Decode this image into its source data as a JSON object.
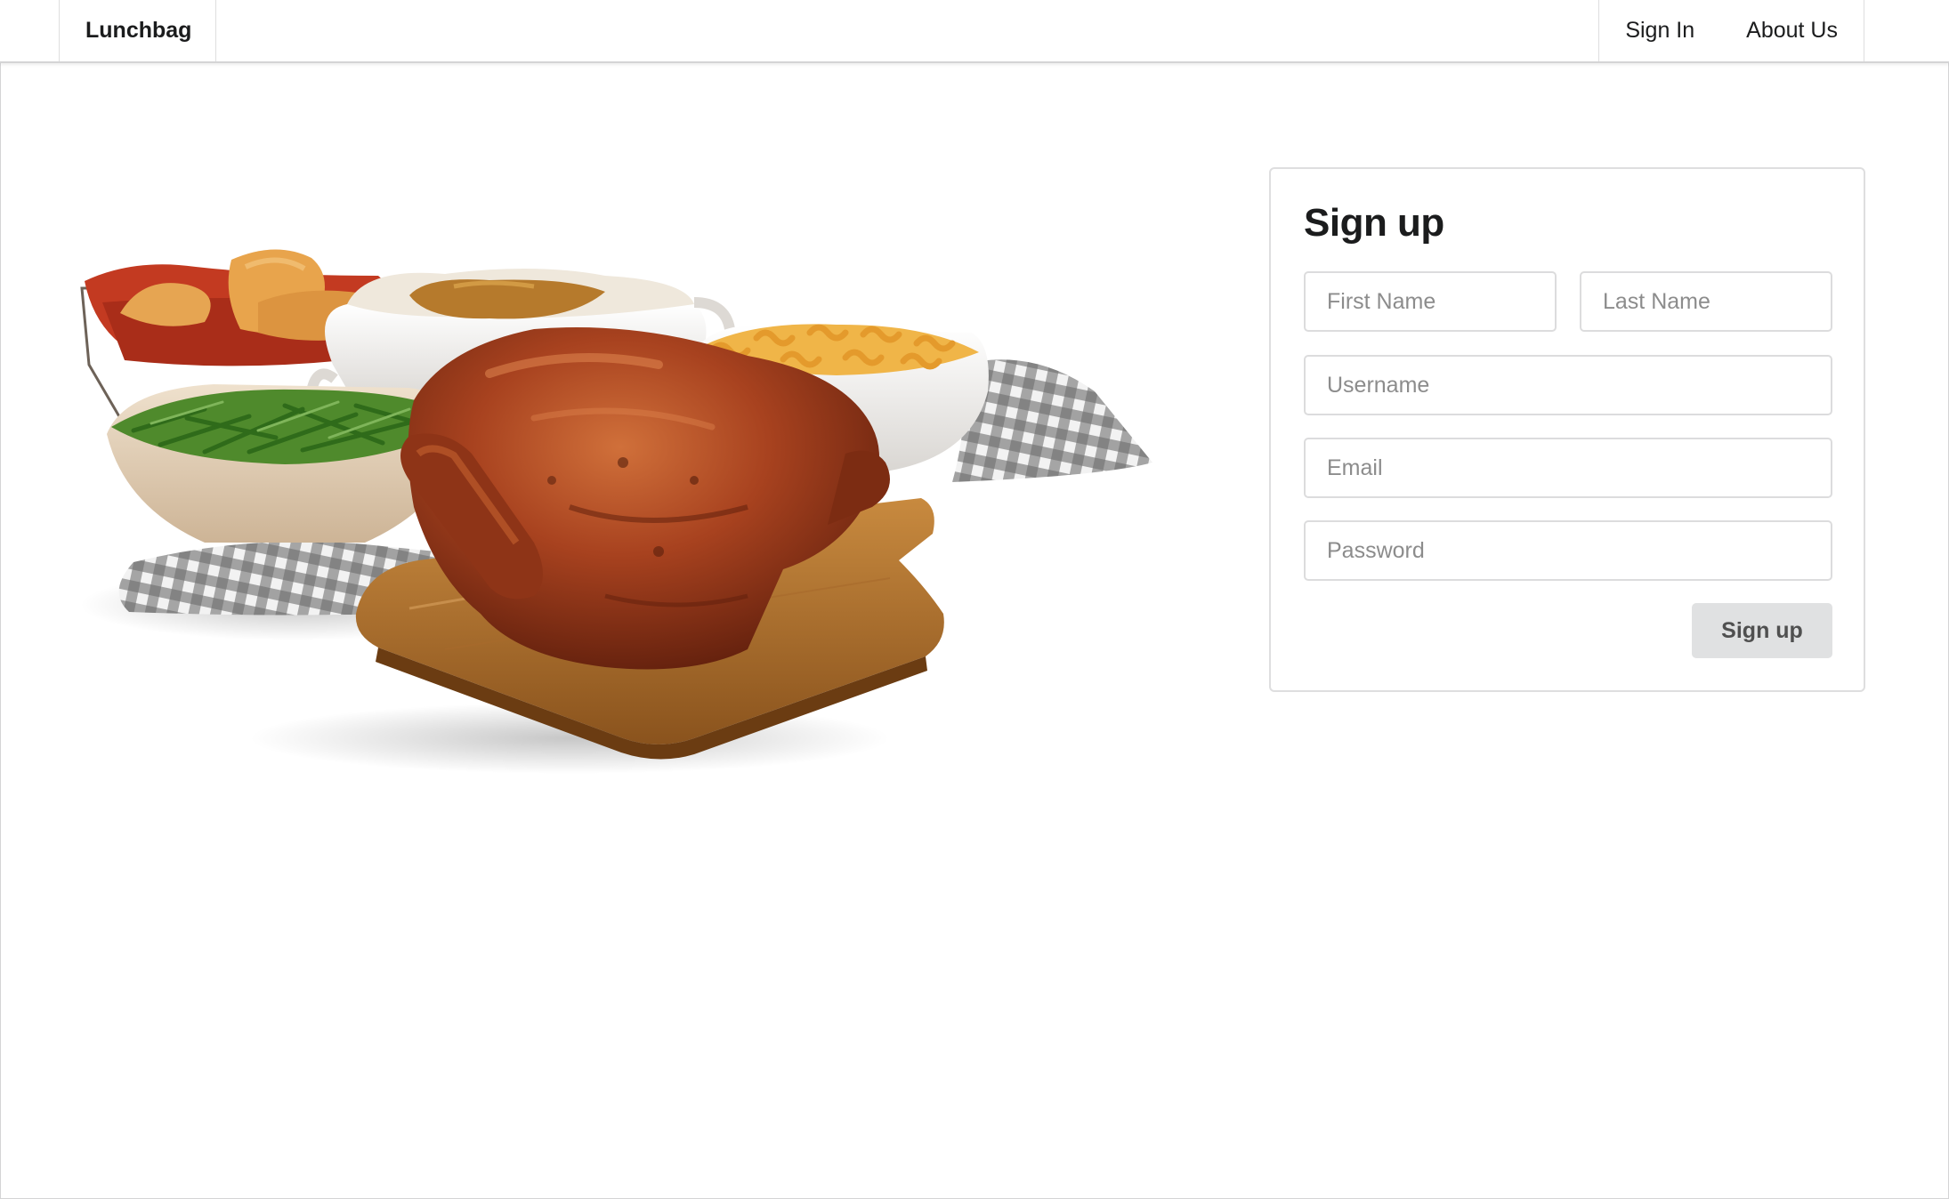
{
  "navbar": {
    "brand": "Lunchbag",
    "links": [
      {
        "label": "Sign In"
      },
      {
        "label": "About Us"
      }
    ]
  },
  "hero": {
    "image": "roast-chicken-meal-photo"
  },
  "signup": {
    "title": "Sign up",
    "first_name_placeholder": "First Name",
    "last_name_placeholder": "Last Name",
    "username_placeholder": "Username",
    "email_placeholder": "Email",
    "password_placeholder": "Password",
    "submit_label": "Sign up"
  },
  "colors": {
    "border": "#d4d4d5",
    "button_bg": "#e0e1e2",
    "button_text": "#505050",
    "placeholder": "#8c8c8c"
  }
}
